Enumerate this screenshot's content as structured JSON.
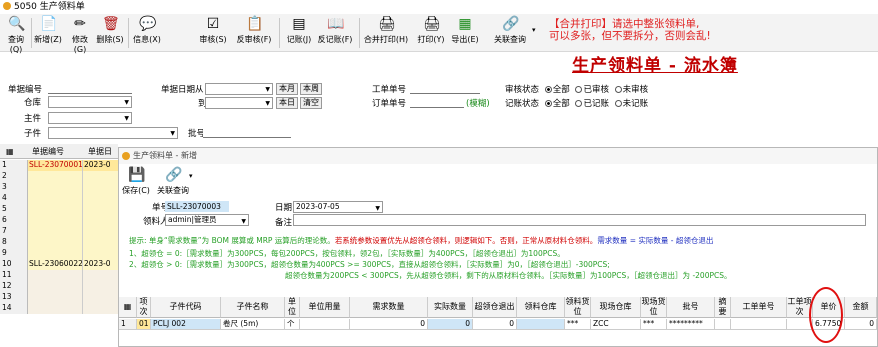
{
  "window": {
    "title": "5050 生产领料单"
  },
  "toolbar": {
    "buttons": [
      {
        "label": "查询(Q)",
        "icon": "search-icon"
      },
      {
        "label": "新增(Z)",
        "icon": "new-icon"
      },
      {
        "label": "修改(G)",
        "icon": "edit-icon"
      },
      {
        "label": "删除(S)",
        "icon": "delete-icon"
      },
      {
        "label": "信息(X)",
        "icon": "info-icon"
      },
      {
        "label": "审核(S)",
        "icon": "approve-icon"
      },
      {
        "label": "反审核(F)",
        "icon": "unapprove-icon"
      },
      {
        "label": "记账(J)",
        "icon": "post-icon"
      },
      {
        "label": "反记账(F)",
        "icon": "unpost-icon"
      },
      {
        "label": "合并打印(H)",
        "icon": "merge-print-icon"
      },
      {
        "label": "打印(Y)",
        "icon": "print-icon"
      },
      {
        "label": "导出(E)",
        "icon": "export-icon"
      },
      {
        "label": "关联查询",
        "icon": "link-query-icon"
      }
    ],
    "notice_line1": "【合并打印】请选中整张领料单,",
    "notice_line2": "可以多张，但不要拆分，否则会乱!"
  },
  "page_title": "生产领料单 - 流水簿",
  "filters": {
    "doc_no_label": "单据编号",
    "warehouse_label": "仓库",
    "main_label": "主件",
    "child_label": "子件",
    "date_from_label": "单据日期从",
    "date_to_label": "到",
    "btn_this_month": "本月",
    "btn_this_week": "本周",
    "btn_today": "本日",
    "btn_clear": "清空",
    "batch_label": "批号",
    "work_order_label": "工单单号",
    "order_no_label": "订单单号",
    "fuzzy_label": "(模糊)",
    "audit_status_label": "审核状态",
    "audit_options": [
      "全部",
      "已审核",
      "未审核"
    ],
    "post_status_label": "记账状态",
    "post_options": [
      "全部",
      "已记账",
      "未记账"
    ]
  },
  "left_grid": {
    "headers": [
      "单据编号",
      "单据日"
    ],
    "rows": [
      {
        "n": "1",
        "c1": "SLL-23070001",
        "c2": "2023-0"
      },
      {
        "n": "2",
        "c1": "",
        "c2": ""
      },
      {
        "n": "3",
        "c1": "",
        "c2": ""
      },
      {
        "n": "4",
        "c1": "",
        "c2": ""
      },
      {
        "n": "5",
        "c1": "",
        "c2": ""
      },
      {
        "n": "6",
        "c1": "",
        "c2": ""
      },
      {
        "n": "7",
        "c1": "",
        "c2": ""
      },
      {
        "n": "8",
        "c1": "",
        "c2": ""
      },
      {
        "n": "9",
        "c1": "",
        "c2": ""
      },
      {
        "n": "10",
        "c1": "SLL-23060022",
        "c2": "2023-0"
      },
      {
        "n": "11",
        "c1": "",
        "c2": ""
      },
      {
        "n": "12",
        "c1": "",
        "c2": ""
      },
      {
        "n": "13",
        "c1": "",
        "c2": ""
      },
      {
        "n": "14",
        "c1": "",
        "c2": ""
      }
    ]
  },
  "child": {
    "title": "生产领料单 - 新增",
    "save_label": "保存(C)",
    "link_label": "关联查询",
    "doc_no_label": "单号",
    "doc_no_value": "SLL-23070003",
    "date_label": "日期",
    "date_value": "2023-07-05",
    "picker_label": "领料人",
    "picker_value": "admin|管理员",
    "remark_label": "备注",
    "hint_line1_a": "提示: 单身“需求数量”为 BOM 展算或 MRP 运算后的理论数。",
    "hint_line1_b": "若系统参数设置优先从超领仓领料，则逻辑如下。否则，正常从原材料仓领料。",
    "hint_line1_c": "需求数量 = 实际数量 - 超领仓退出",
    "hint_line2": "1、超领仓 = 0:［需求数量］为300PCS，每包200PCS，按包领料，领2包，［实际数量］为400PCS，［超领仓退出］为100PCS。",
    "hint_line3": "2、超领仓 > 0:［需求数量］为300PCS，超领仓数量为400PCS >= 300PCS，直接从超领仓领料，［实际数量］为0，［超领仓退出］-300PCS;",
    "hint_line4": "超领仓数量为200PCS < 300PCS，先从超领仓领料，剩下的从原材料仓领料。［实际数量］为100PCS，［超领仓退出］为 -200PCS。",
    "columns": [
      "项次",
      "子件代码",
      "子件名称",
      "单位",
      "单位用量",
      "需求数量",
      "实际数量",
      "超领仓退出",
      "领料仓库",
      "领料货位",
      "现场仓库",
      "现场货位",
      "批号",
      "摘要",
      "工单单号",
      "工单项次",
      "单价",
      "金额"
    ],
    "row": {
      "item": "01",
      "code": "PCLJ 002",
      "name": "卷尺 (5m)",
      "unit": "个",
      "usage": "",
      "demand": "0",
      "actual": "0",
      "over_return": "0",
      "pick_wh": "",
      "pick_loc": "***",
      "site_wh": "ZCC",
      "site_loc": "***",
      "batch": "*********",
      "memo": "",
      "wo_no": "",
      "wo_item": "",
      "price": "6.7750",
      "amount": "0"
    },
    "row_num": "1"
  }
}
